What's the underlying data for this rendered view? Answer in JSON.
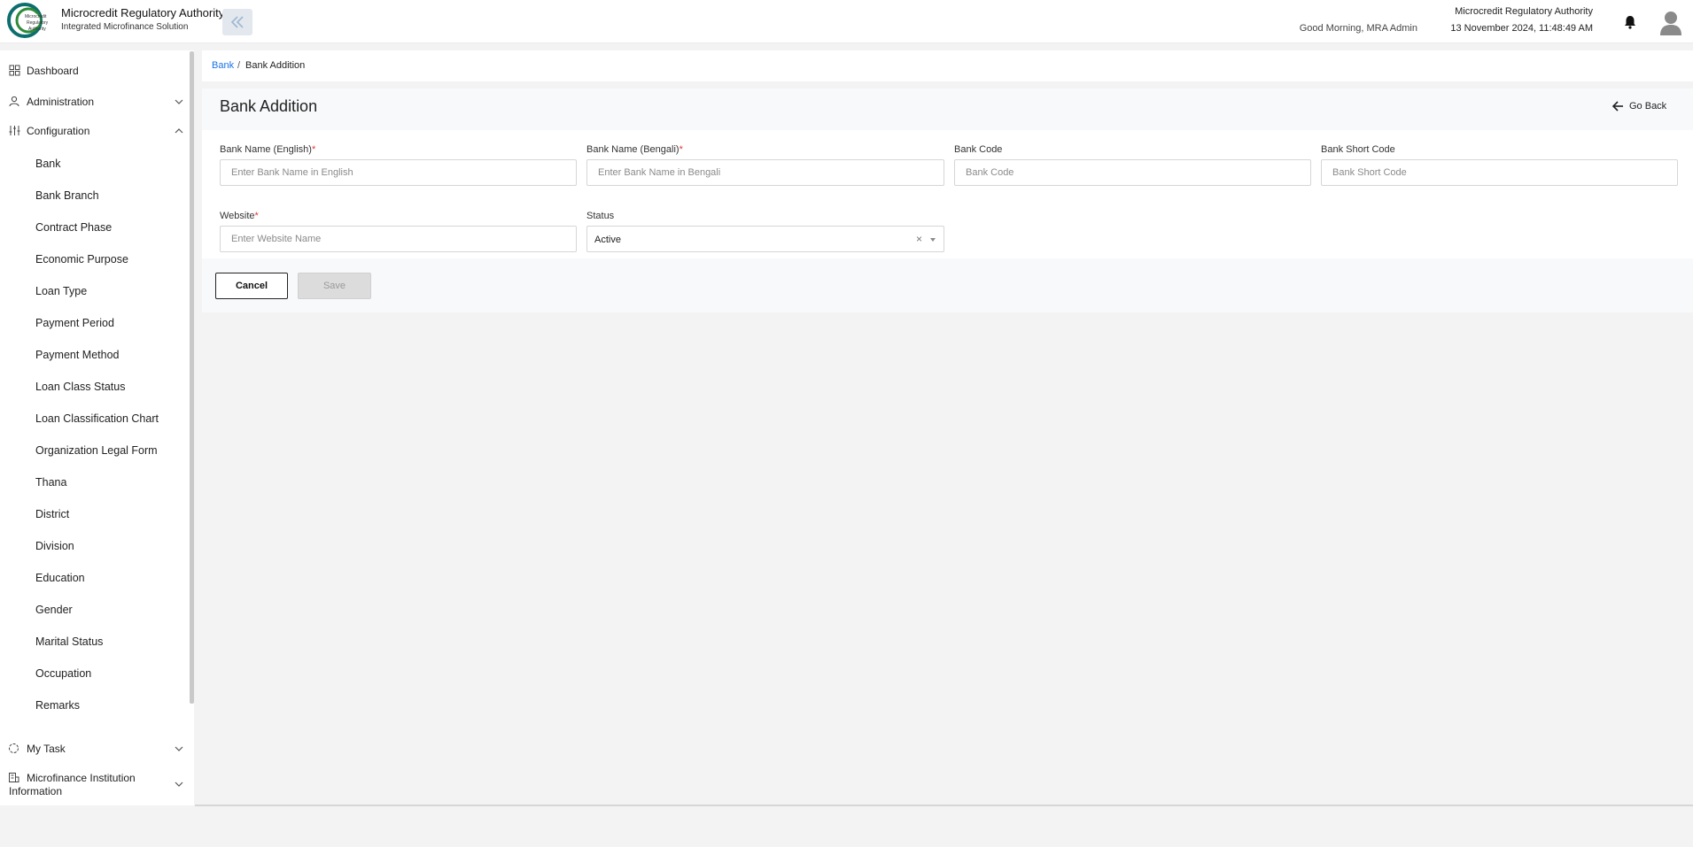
{
  "header": {
    "app_title": "Microcredit Regulatory Authority",
    "app_subtitle": "Integrated Microfinance Solution",
    "greeting": "Good Morning, MRA Admin",
    "org_name": "Microcredit Regulatory Authority",
    "datetime": "13 November 2024, 11:48:49 AM",
    "logo_text": [
      "Microcredit",
      "Regulatory",
      "Authority"
    ]
  },
  "sidebar": {
    "items": [
      {
        "label": "Dashboard",
        "icon": "grid-icon"
      },
      {
        "label": "Administration",
        "icon": "users-icon",
        "expanded": false
      },
      {
        "label": "Configuration",
        "icon": "sliders-icon",
        "expanded": true
      },
      {
        "label": "My Task",
        "icon": "refresh-icon",
        "expanded": false
      },
      {
        "label": "Microfinance Institution Information",
        "icon": "building-icon",
        "expanded": false
      }
    ],
    "configuration_items": [
      "Bank",
      "Bank Branch",
      "Contract Phase",
      "Economic Purpose",
      "Loan Type",
      "Payment Period",
      "Payment Method",
      "Loan Class Status",
      "Loan Classification Chart",
      "Organization Legal Form",
      "Thana",
      "District",
      "Division",
      "Education",
      "Gender",
      "Marital Status",
      "Occupation",
      "Remarks"
    ]
  },
  "breadcrumb": {
    "parent": "Bank",
    "separator": "/",
    "current": "Bank Addition"
  },
  "page": {
    "title": "Bank Addition",
    "go_back": "Go Back"
  },
  "form": {
    "bank_name_en": {
      "label": "Bank Name (English)",
      "required": "*",
      "placeholder": "Enter Bank Name in English",
      "value": ""
    },
    "bank_name_bn": {
      "label": "Bank Name (Bengali)",
      "required": "*",
      "placeholder": "Enter Bank Name in Bengali",
      "value": ""
    },
    "bank_code": {
      "label": "Bank Code",
      "placeholder": "Bank Code",
      "value": ""
    },
    "bank_short_code": {
      "label": "Bank Short Code",
      "placeholder": "Bank Short Code",
      "value": ""
    },
    "website": {
      "label": "Website",
      "required": "*",
      "placeholder": "Enter Website Name",
      "value": ""
    },
    "status": {
      "label": "Status",
      "value": "Active",
      "clear": "×"
    }
  },
  "actions": {
    "cancel": "Cancel",
    "save": "Save"
  },
  "colors": {
    "accent": "#1a73e8",
    "required": "#e53935",
    "logo_green": "#2e8b3a",
    "logo_teal": "#0d6e6e"
  }
}
